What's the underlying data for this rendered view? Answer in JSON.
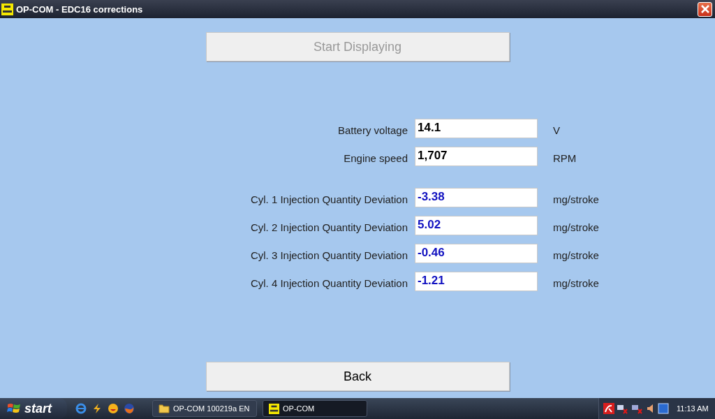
{
  "window": {
    "title": "OP-COM - EDC16 corrections"
  },
  "start_button": {
    "label": "Start Displaying",
    "disabled": true
  },
  "readings": [
    {
      "label": "Battery voltage",
      "value": "14.1",
      "unit": "V",
      "kind": "status"
    },
    {
      "label": "Engine speed",
      "value": "1,707",
      "unit": "RPM",
      "kind": "status"
    },
    {
      "label": "Cyl. 1 Injection Quantity Deviation",
      "value": "-3.38",
      "unit": "mg/stroke",
      "kind": "deviation"
    },
    {
      "label": "Cyl. 2 Injection Quantity Deviation",
      "value": "5.02",
      "unit": "mg/stroke",
      "kind": "deviation"
    },
    {
      "label": "Cyl. 3 Injection Quantity Deviation",
      "value": "-0.46",
      "unit": "mg/stroke",
      "kind": "deviation"
    },
    {
      "label": "Cyl. 4 Injection Quantity Deviation",
      "value": "-1.21",
      "unit": "mg/stroke",
      "kind": "deviation"
    }
  ],
  "back_button": {
    "label": "Back",
    "disabled": false
  },
  "taskbar": {
    "start": "start",
    "tasks": [
      {
        "label": "OP-COM 100219a EN",
        "kind": "folder",
        "selected": false
      },
      {
        "label": "OP-COM",
        "kind": "app",
        "selected": true
      }
    ],
    "clock": "11:13 AM"
  }
}
